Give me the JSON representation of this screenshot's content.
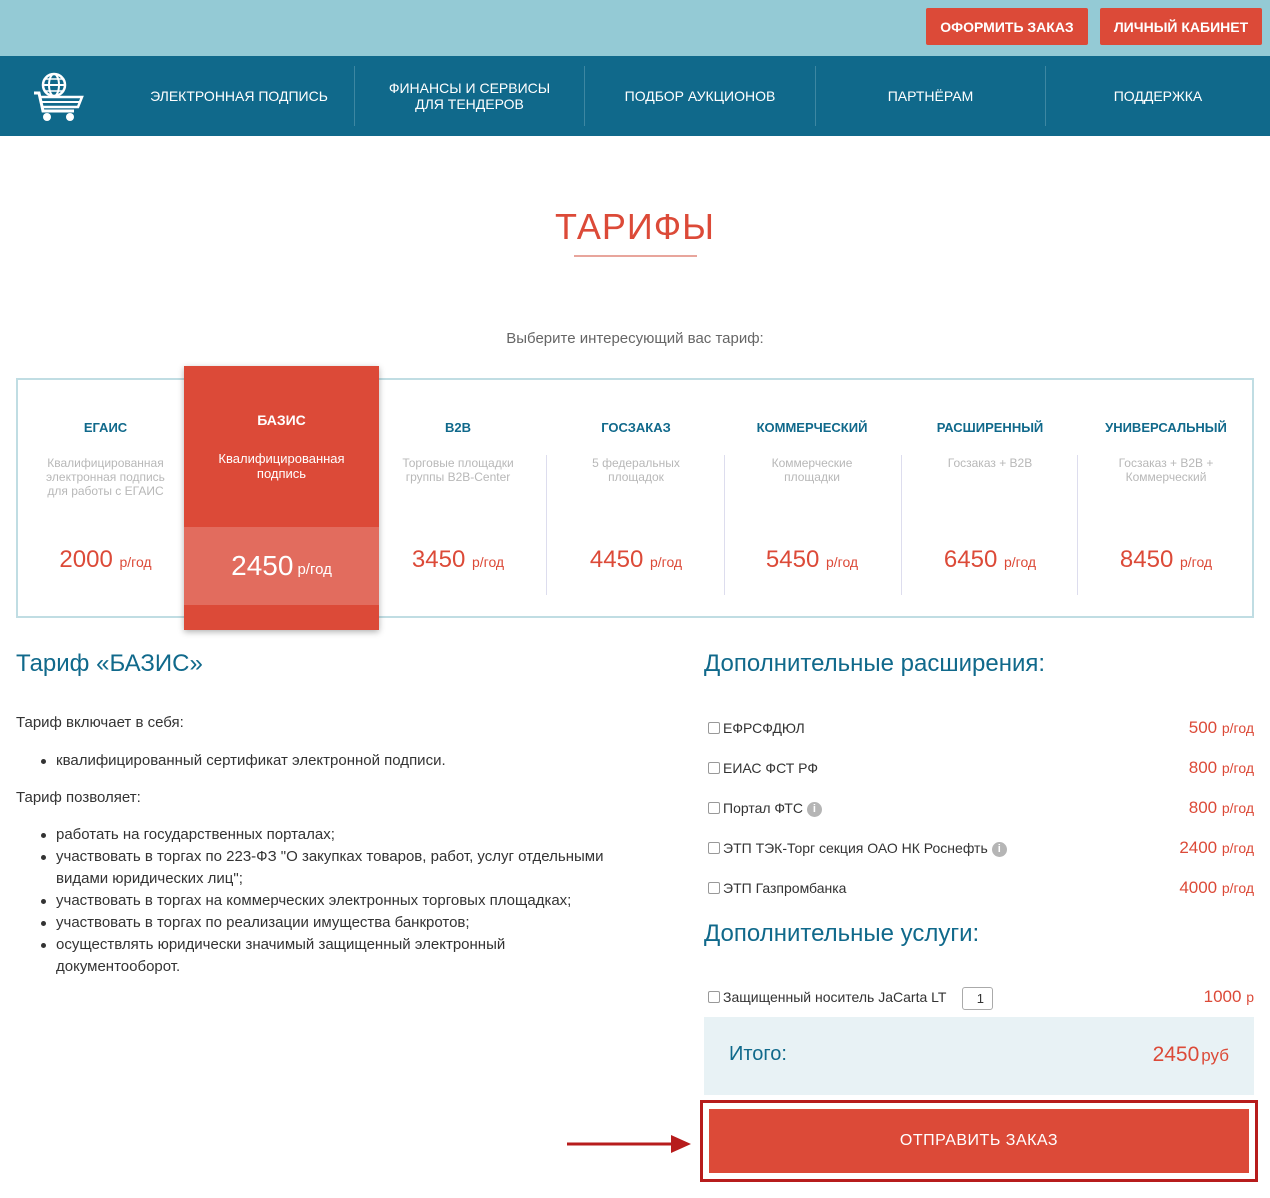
{
  "header": {
    "order_button": "ОФОРМИТЬ ЗАКАЗ",
    "cabinet_button": "ЛИЧНЫЙ КАБИНЕТ"
  },
  "nav": {
    "items": [
      "ЭЛЕКТРОННАЯ ПОДПИСЬ",
      "ФИНАНСЫ И СЕРВИСЫ ДЛЯ ТЕНДЕРОВ",
      "ПОДБОР АУКЦИОНОВ",
      "ПАРТНЁРАМ",
      "ПОДДЕРЖКА"
    ]
  },
  "page": {
    "title": "ТАРИФЫ",
    "subtitle": "Выберите интересующий вас тариф:"
  },
  "tariffs": [
    {
      "name": "ЕГАИС",
      "desc": "Квалифицированная электронная подпись для работы с ЕГАИС",
      "price": "2000",
      "unit": "р/год"
    },
    {
      "name": "БАЗИС",
      "desc": "Квалифицированная подпись",
      "price": "2450",
      "unit": "р/год",
      "selected": true
    },
    {
      "name": "B2B",
      "desc": "Торговые площадки группы B2B-Center",
      "price": "3450",
      "unit": "р/год"
    },
    {
      "name": "ГОСЗАКАЗ",
      "desc": "5 федеральных площадок",
      "price": "4450",
      "unit": "р/год"
    },
    {
      "name": "КОММЕРЧЕСКИЙ",
      "desc": "Коммерческие площадки",
      "price": "5450",
      "unit": "р/год"
    },
    {
      "name": "РАСШИРЕННЫЙ",
      "desc": "Госзаказ + B2B",
      "price": "6450",
      "unit": "р/год"
    },
    {
      "name": "УНИВЕРСАЛЬНЫЙ",
      "desc": "Госзаказ + B2B + Коммерческий",
      "price": "8450",
      "unit": "р/год"
    }
  ],
  "details": {
    "title": "Тариф «БАЗИС»",
    "includes_label": "Тариф включает в себя:",
    "includes": [
      "квалифицированный сертификат электронной подписи."
    ],
    "allows_label": "Тариф позволяет:",
    "allows": [
      "работать на государственных порталах;",
      "участвовать в торгах по 223-ФЗ \"О закупках товаров, работ, услуг отдельными видами юридических лиц\";",
      "участвовать в торгах на коммерческих электронных торговых площадках;",
      "участвовать в торгах по реализации имущества банкротов;",
      "осуществлять юридически значимый защищенный электронный документооборот."
    ]
  },
  "extensions": {
    "title": "Дополнительные расширения:",
    "items": [
      {
        "label": "ЕФРСФДЮЛ",
        "price": "500",
        "unit": "р/год"
      },
      {
        "label": "ЕИАС ФСТ РФ",
        "price": "800",
        "unit": "р/год"
      },
      {
        "label": "Портал ФТС",
        "price": "800",
        "unit": "р/год",
        "info": true
      },
      {
        "label": "ЭТП ТЭК-Торг секция ОАО НК Роснефть",
        "price": "2400",
        "unit": "р/год",
        "info": true
      },
      {
        "label": "ЭТП Газпромбанка",
        "price": "4000",
        "unit": "р/год"
      }
    ]
  },
  "services": {
    "title": "Дополнительные услуги:",
    "items": [
      {
        "label": "Защищенный носитель JaCarta LT",
        "qty": "1",
        "price": "1000",
        "unit": "р"
      }
    ]
  },
  "total": {
    "label": "Итого:",
    "value": "2450",
    "unit": "руб"
  },
  "submit": "ОТПРАВИТЬ ЗАКАЗ",
  "colors": {
    "accent": "#dc4a38",
    "nav": "#10698b",
    "topbar": "#94cad5"
  }
}
